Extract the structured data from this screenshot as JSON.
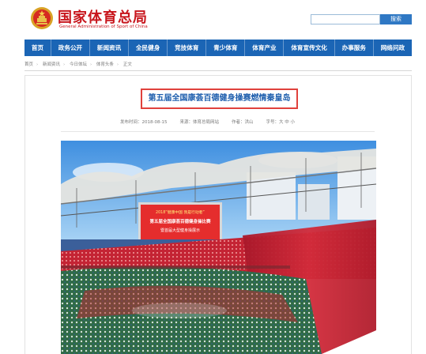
{
  "site": {
    "title": "国家体育总局",
    "subtitle": "General Administration of Sport of China"
  },
  "search": {
    "placeholder": "",
    "button_label": "搜索"
  },
  "nav": {
    "items": [
      "首页",
      "政务公开",
      "新闻资讯",
      "全民健身",
      "竞技体育",
      "青少体育",
      "体育产业",
      "体育宣传文化",
      "办事服务",
      "网络问政"
    ]
  },
  "breadcrumb": [
    "首页",
    "新闻资讯",
    "今日体坛",
    "体育头条",
    "正文"
  ],
  "article": {
    "headline": "第五届全国康荟百德健身操赛燃情秦皇岛",
    "meta": {
      "time": "发布时间：2018-08-15",
      "source": "来源：体育总局网站",
      "author": "作者：洪山",
      "font_size": "字号：大 中 小"
    },
    "screen_text": [
      "2018“健康中国 我是行动者”",
      "第五届全国康荟百德健身操比赛",
      "暨首届大型健身操展示"
    ]
  },
  "colors": {
    "brand_red": "#c8161d",
    "nav_blue": "#1b65b5",
    "headline_blue": "#1f5fae",
    "highlight_red": "#e0413c"
  },
  "icons": [
    "national-emblem-icon"
  ]
}
